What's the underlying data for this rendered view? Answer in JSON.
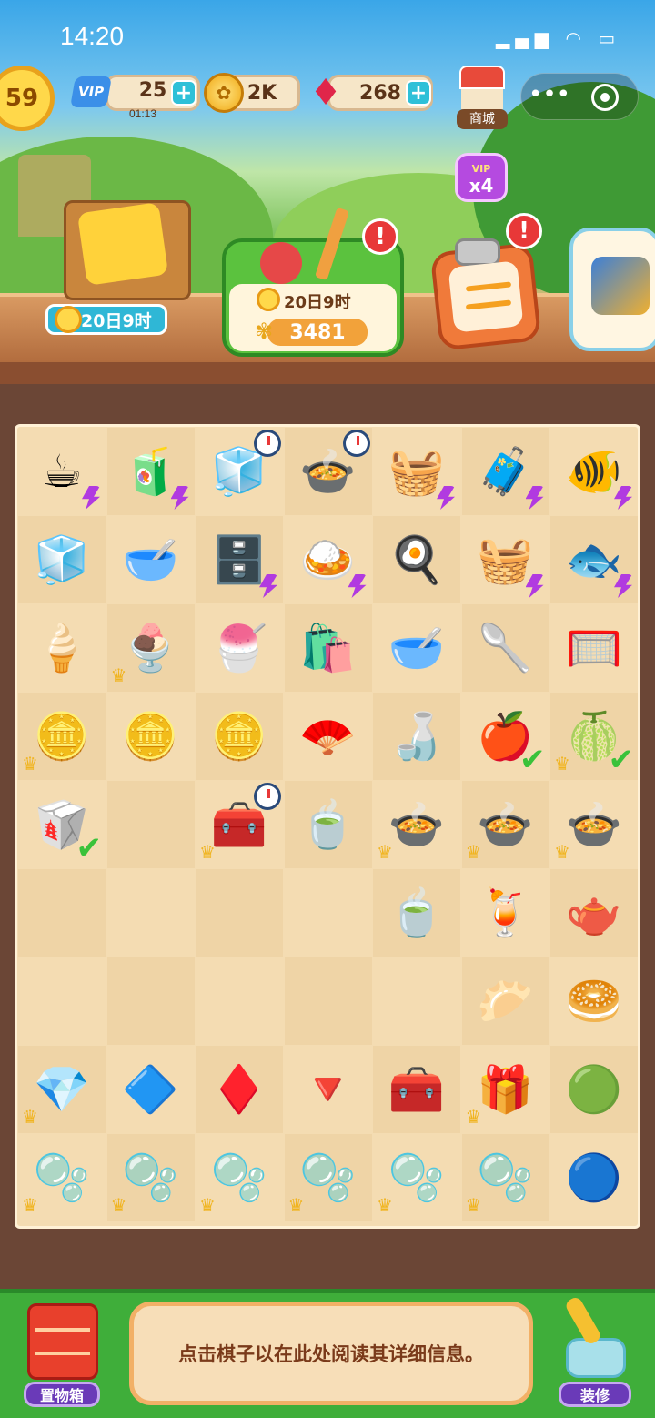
{
  "status_bar": {
    "time": "14:20",
    "icons": "▂▄▆ ◠ ▭"
  },
  "hud": {
    "level": "59",
    "vip_label": "VIP",
    "energy": "25",
    "energy_timer": "01:13",
    "coins": "2K",
    "gems": "268",
    "plus": "+",
    "shop_label": "商城",
    "vip_boost": {
      "tag": "VIP",
      "mult": "x4"
    }
  },
  "capsule": {
    "more": "•••"
  },
  "events": {
    "crate_timer": "20日9时",
    "garden_timer": "20日9时",
    "garden_count": "3481",
    "alert": "!"
  },
  "board": {
    "rows": [
      [
        {
          "icon": "☕",
          "bolt": true
        },
        {
          "icon": "🧃",
          "bolt": true
        },
        {
          "icon": "🧊",
          "timer": true
        },
        {
          "icon": "🍲",
          "timer": true
        },
        {
          "icon": "🧺",
          "bolt": true
        },
        {
          "icon": "🧳",
          "bolt": true
        },
        {
          "icon": "🐠",
          "bolt": true
        }
      ],
      [
        {
          "icon": "🧊"
        },
        {
          "icon": "🥣"
        },
        {
          "icon": "🗄️",
          "bolt": true
        },
        {
          "icon": "🍛",
          "bolt": true
        },
        {
          "icon": "🍳"
        },
        {
          "icon": "🧺",
          "bolt": true
        },
        {
          "icon": "🐟",
          "bolt": true
        }
      ],
      [
        {
          "icon": "🍦"
        },
        {
          "icon": "🍨",
          "crown": true
        },
        {
          "icon": "🍧"
        },
        {
          "icon": "🛍️"
        },
        {
          "icon": "🥣"
        },
        {
          "icon": "🥄"
        },
        {
          "icon": "🥅"
        }
      ],
      [
        {
          "icon": "🪙",
          "crown": true
        },
        {
          "icon": "🪙"
        },
        {
          "icon": "🪙"
        },
        {
          "icon": "🪭"
        },
        {
          "icon": "🍶"
        },
        {
          "icon": "🍎",
          "check": true
        },
        {
          "icon": "🍈",
          "crown": true,
          "check": true
        }
      ],
      [
        {
          "icon": "🥡",
          "check": true
        },
        {
          "icon": ""
        },
        {
          "icon": "🧰",
          "crown": true,
          "timer": true
        },
        {
          "icon": "🍵"
        },
        {
          "icon": "🍲",
          "crown": true
        },
        {
          "icon": "🍲",
          "crown": true
        },
        {
          "icon": "🍲",
          "crown": true
        }
      ],
      [
        {
          "icon": ""
        },
        {
          "icon": ""
        },
        {
          "icon": ""
        },
        {
          "icon": ""
        },
        {
          "icon": "🍵"
        },
        {
          "icon": "🍹"
        },
        {
          "icon": "🫖"
        }
      ],
      [
        {
          "icon": ""
        },
        {
          "icon": ""
        },
        {
          "icon": ""
        },
        {
          "icon": ""
        },
        {
          "icon": ""
        },
        {
          "icon": "🥟"
        },
        {
          "icon": "🥯"
        }
      ],
      [
        {
          "icon": "💎",
          "crown": true
        },
        {
          "icon": "🔷"
        },
        {
          "icon": "♦️"
        },
        {
          "icon": "🔻"
        },
        {
          "icon": "🧰"
        },
        {
          "icon": "🎁",
          "crown": true
        },
        {
          "icon": "🟢"
        }
      ],
      [
        {
          "icon": "🫧",
          "crown": true
        },
        {
          "icon": "🫧",
          "crown": true
        },
        {
          "icon": "🫧",
          "crown": true
        },
        {
          "icon": "🫧",
          "crown": true
        },
        {
          "icon": "🫧",
          "crown": true
        },
        {
          "icon": "🫧",
          "crown": true
        },
        {
          "icon": "🔵"
        }
      ]
    ]
  },
  "bottom": {
    "storage_label": "置物箱",
    "info_text": "点击棋子以在此处阅读其详细信息。",
    "decorate_label": "装修"
  },
  "colors": {
    "accent": "#3fae3a",
    "board": "#f4dcb2",
    "frame": "#6b4636"
  }
}
